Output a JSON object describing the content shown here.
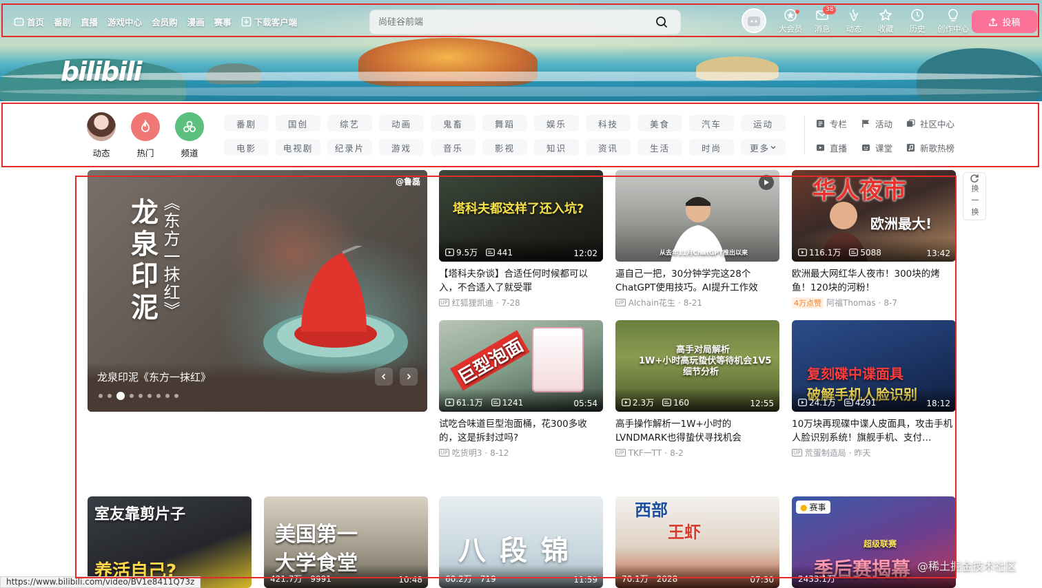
{
  "nav": {
    "links": [
      "首页",
      "番剧",
      "直播",
      "游戏中心",
      "会员购",
      "漫画",
      "赛事",
      "下载客户端"
    ],
    "search_placeholder": "尚硅谷前端",
    "right_items": [
      {
        "label": "大会员",
        "icon": "vip-icon"
      },
      {
        "label": "消息",
        "icon": "message-icon",
        "badge": "38"
      },
      {
        "label": "动态",
        "icon": "dynamic-icon"
      },
      {
        "label": "收藏",
        "icon": "star-icon"
      },
      {
        "label": "历史",
        "icon": "clock-icon"
      },
      {
        "label": "创作中心",
        "icon": "lightbulb-icon"
      }
    ],
    "upload_label": "投稿",
    "logo_text": "bilibili"
  },
  "channels": {
    "quick": [
      {
        "label": "动态",
        "color": "#d8c9c2"
      },
      {
        "label": "热门",
        "color": "#f07775"
      },
      {
        "label": "频道",
        "color": "#5bc07e"
      }
    ],
    "items": [
      "番剧",
      "国创",
      "综艺",
      "动画",
      "鬼畜",
      "舞蹈",
      "娱乐",
      "科技",
      "美食",
      "汽车",
      "运动",
      "电影",
      "电视剧",
      "纪录片",
      "游戏",
      "音乐",
      "影视",
      "知识",
      "资讯",
      "生活",
      "时尚",
      "更多"
    ],
    "extras": [
      "专栏",
      "活动",
      "社区中心",
      "直播",
      "课堂",
      "新歌热榜"
    ]
  },
  "carousel": {
    "caption": "龙泉印泥《东方一抹红》",
    "vertical_title": "龙泉印泥",
    "vertical_subtitle": "《东方一抹红》",
    "watermark": "@鲁磊",
    "active_dot": 3,
    "dot_count": 9
  },
  "cards": [
    {
      "title": "【塔科夫杂谈】合适任何时候都可以入，不合适入了就受罪",
      "views": "9.5万",
      "danmaku": "441",
      "duration": "12:02",
      "author": "红狐狸凯迪",
      "date": "7-28",
      "overlay": "塔科夫都这样了还入坑?"
    },
    {
      "title": "逼自己一把，30分钟学完这28个ChatGPT使用技巧。AI提升工作效率，…",
      "views": "",
      "danmaku": "",
      "duration": "",
      "author": "AIchain花生",
      "date": "8-21",
      "overlay": "从去年11月ChatGPT推出以来"
    },
    {
      "title": "欧洲最大网红华人夜市！300块的烤鱼！120块的河粉！",
      "views": "116.1万",
      "danmaku": "5088",
      "duration": "13:42",
      "author": "阿福Thomas",
      "date": "8-7",
      "likes": "4万点赞",
      "overlay": "华人夜市",
      "overlay2": "欧洲最大!"
    },
    {
      "title": "试吃合味道巨型泡面桶，花300多收的，这是拆封过吗?",
      "views": "61.1万",
      "danmaku": "1241",
      "duration": "05:54",
      "author": "吃货明3",
      "date": "8-12",
      "overlay": "巨型泡面"
    },
    {
      "title": "高手操作解析一1W+小时的LVNDMARK也得蛰伏寻找机会",
      "views": "2.3万",
      "danmaku": "160",
      "duration": "12:55",
      "author": "TKF一TT",
      "date": "8-2",
      "overlay": "高手对局解析",
      "overlay2": "1W+小时高玩蛰伏等待机会1V5",
      "overlay3": "细节分析"
    },
    {
      "title": "10万块再现碟中谍人皮面具，攻击手机人脸识别系统！旗舰手机、支付…",
      "views": "24.1万",
      "danmaku": "4291",
      "duration": "18:12",
      "author": "荒蛋制造局",
      "date": "昨天",
      "overlay": "复刻碟中谍面具",
      "overlay2": "破解手机人脸识别"
    },
    {
      "title": "",
      "views": "",
      "danmaku": "",
      "duration": "",
      "author": "",
      "date": "",
      "overlay": "室友靠剪片子",
      "overlay2": "养活自己?"
    },
    {
      "title": "",
      "views": "421.7万",
      "danmaku": "9991",
      "duration": "10:48",
      "author": "",
      "date": "",
      "overlay": "美国第一",
      "overlay2": "大学食堂"
    },
    {
      "title": "",
      "views": "60.2万",
      "danmaku": "719",
      "duration": "11:59",
      "author": "",
      "date": "",
      "overlay": "八段锦"
    },
    {
      "title": "",
      "views": "70.1万",
      "danmaku": "2028",
      "duration": "07:30",
      "author": "",
      "date": "",
      "overlay": "西部",
      "overlay2": "王虾"
    },
    {
      "title": "",
      "views": "2433.1万",
      "danmaku": "",
      "duration": "",
      "author": "",
      "date": "",
      "overlay": "季后赛揭幕",
      "tag": "赛事",
      "overlay2": "超级联赛"
    }
  ],
  "refresh": {
    "label": "换一换"
  },
  "status_url": "https://www.bilibili.com/video/BV1e8411Q73z",
  "site_watermark": "@稀土掘金技术社区"
}
